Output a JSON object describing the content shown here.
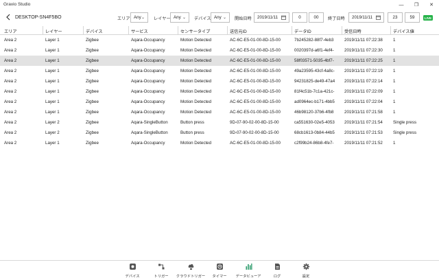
{
  "app_title": "Gravio Studio",
  "window_controls": {
    "minimize": "—",
    "restore": "❐",
    "close": "✕"
  },
  "header": {
    "device_name": "DESKTOP-SN4F5BO",
    "area_label": "エリア",
    "area_value": "Any",
    "layer_label": "レイヤー",
    "layer_value": "Any",
    "device_label": "デバイス",
    "device_value": "Any",
    "start_label": "開始日時",
    "start_date": "2019/11/11",
    "start_hour": "0",
    "start_minute": "00",
    "end_label": "終了日時",
    "end_date": "2019/11/11",
    "end_hour": "23",
    "end_minute": "59",
    "live": "LIVE"
  },
  "columns": [
    "エリア",
    "レイヤー",
    "デバイス",
    "サービス",
    "センサータイプ",
    "送信元ID",
    "データID",
    "受信日時",
    "デバイス値"
  ],
  "rows": [
    [
      "Area  2",
      "Layer 1",
      "Zigbee",
      "Aqara-Occupancy",
      "Motion Detected",
      "AC-6C-E5-01-00-8D-15-00",
      "7b245282-88f7-4eb3",
      "2019/11/11 07:22:38",
      "1"
    ],
    [
      "Area  2",
      "Layer 1",
      "Zigbee",
      "Aqara-Occupancy",
      "Motion Detected",
      "AC-6C-E5-01-00-8D-15-00",
      "0020397d-a6f1-4ef4-",
      "2019/11/11 07:22:30",
      "1"
    ],
    [
      "Area  2",
      "Layer 1",
      "Zigbee",
      "Aqara-Occupancy",
      "Motion Detected",
      "AC-6C-E5-01-00-8D-15-00",
      "58f03571-5035-4bf7-",
      "2019/11/11 07:22:25",
      "1"
    ],
    [
      "Area  2",
      "Layer 1",
      "Zigbee",
      "Aqara-Occupancy",
      "Motion Detected",
      "AC-6C-E5-01-00-8D-15-00",
      "49a23595-43cf-4a8c-",
      "2019/11/11 07:22:19",
      "1"
    ],
    [
      "Area  2",
      "Layer 1",
      "Zigbee",
      "Aqara-Occupancy",
      "Motion Detected",
      "AC-6C-E5-01-00-8D-15-00",
      "94231825-de49-47a4",
      "2019/11/11 07:22:14",
      "1"
    ],
    [
      "Area  2",
      "Layer 1",
      "Zigbee",
      "Aqara-Occupancy",
      "Motion Detected",
      "AC-6C-E5-01-00-8D-15-00",
      "81f4c51b-7c1a-421c-",
      "2019/11/11 07:22:09",
      "1"
    ],
    [
      "Area  2",
      "Layer 1",
      "Zigbee",
      "Aqara-Occupancy",
      "Motion Detected",
      "AC-6C-E5-01-00-8D-15-00",
      "ad0964ec-b171-4bb5",
      "2019/11/11 07:22:04",
      "1"
    ],
    [
      "Area  2",
      "Layer 1",
      "Zigbee",
      "Aqara-Occupancy",
      "Motion Detected",
      "AC-6C-E5-01-00-8D-15-00",
      "46b98120-37b6-4fb8",
      "2019/11/11 07:21:58",
      "1"
    ],
    [
      "Area  2",
      "Layer 2",
      "Zigbee",
      "Aqara-SingleButton",
      "Button press",
      "9D-07-90-02-00-8D-15-00",
      "ca551630-02e5-4053",
      "2019/11/11 07:21:54",
      "Single press"
    ],
    [
      "Area  2",
      "Layer 2",
      "Zigbee",
      "Aqara-SingleButton",
      "Button press",
      "9D-07-90-02-00-8D-15-00",
      "68cb1613-0b84-44b5",
      "2019/11/11 07:21:53",
      "Single press"
    ],
    [
      "Area  2",
      "Layer 1",
      "Zigbee",
      "Aqara-Occupancy",
      "Motion Detected",
      "AC-6C-E5-01-00-8D-15-00",
      "c2f99b24-86b8-4fe7-",
      "2019/11/11 07:21:52",
      "1"
    ]
  ],
  "selected_row": 2,
  "nav": [
    {
      "label": "デバイス",
      "icon": "device-icon"
    },
    {
      "label": "トリガー",
      "icon": "trigger-icon"
    },
    {
      "label": "クラウドトリガー",
      "icon": "cloud-trigger-icon"
    },
    {
      "label": "タイマー",
      "icon": "timer-icon"
    },
    {
      "label": "データビューア",
      "icon": "data-viewer-icon"
    },
    {
      "label": "ログ",
      "icon": "log-icon"
    },
    {
      "label": "設定",
      "icon": "settings-icon"
    }
  ],
  "colors": {
    "live": "#27b34a",
    "active_nav": "#2a9a6a",
    "selected_row": "#e2e2e2"
  }
}
